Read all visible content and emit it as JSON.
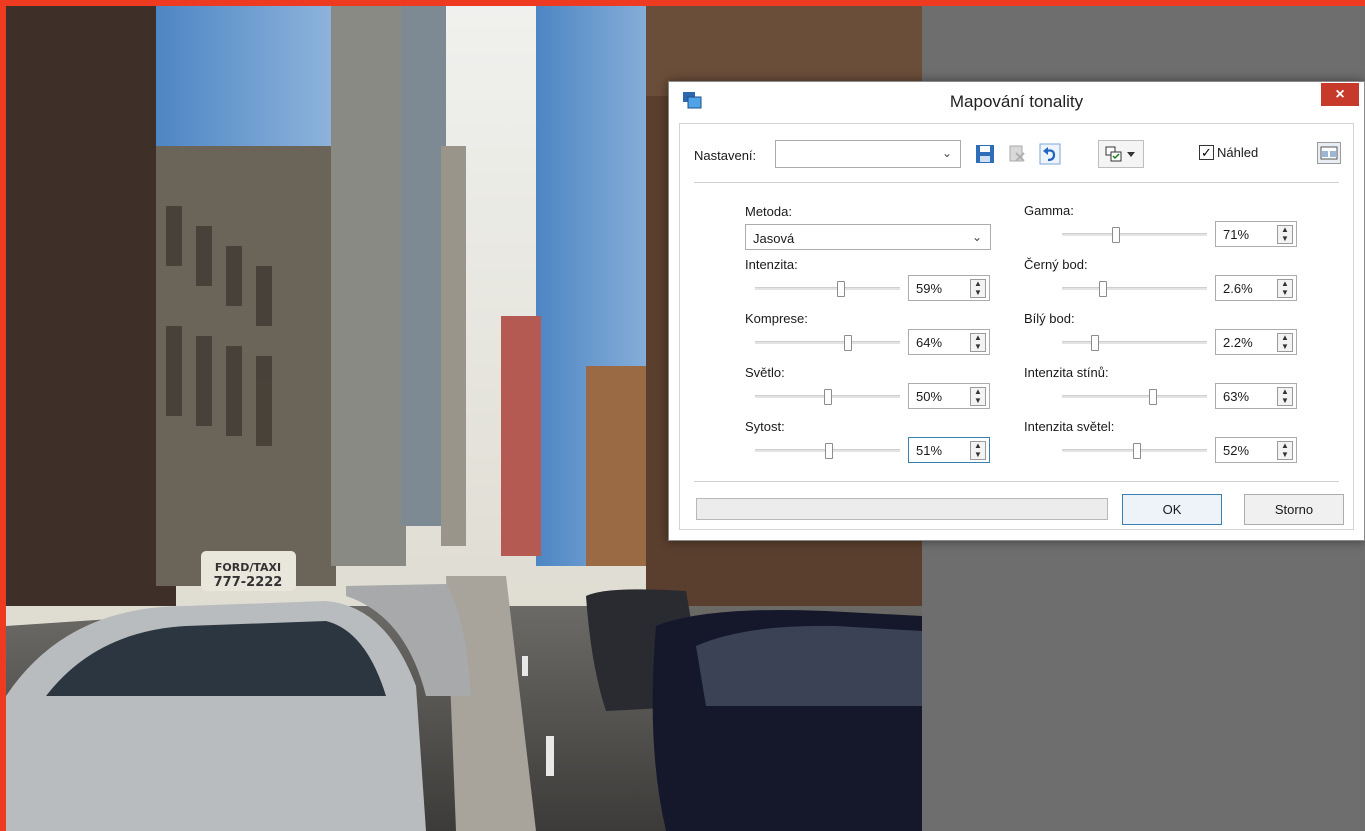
{
  "dialog": {
    "title": "Mapování tonality",
    "close_label": "×"
  },
  "toolbar": {
    "preset_label": "Nastavení:",
    "preset_value": "",
    "preview_label": "Náhled",
    "preview_checked": true
  },
  "left_params": {
    "method_label": "Metoda:",
    "method_value": "Jasová",
    "items": [
      {
        "label": "Intenzita:",
        "value_text": "59%",
        "level": 0.59
      },
      {
        "label": "Komprese:",
        "value_text": "64%",
        "level": 0.64
      },
      {
        "label": "Světlo:",
        "value_text": "50%",
        "level": 0.5
      },
      {
        "label": "Sytost:",
        "value_text": "51%",
        "level": 0.51
      }
    ]
  },
  "right_params": {
    "items": [
      {
        "label": "Gamma:",
        "value_text": "71%",
        "level": 0.37
      },
      {
        "label": "Černý bod:",
        "value_text": "2.6%",
        "level": 0.28
      },
      {
        "label": "Bílý bod:",
        "value_text": "2.2%",
        "level": 0.23
      },
      {
        "label": "Intenzita stínů:",
        "value_text": "63%",
        "level": 0.63
      },
      {
        "label": "Intenzita světel:",
        "value_text": "52%",
        "level": 0.52
      }
    ]
  },
  "buttons": {
    "ok_label": "OK",
    "cancel_label": "Storno"
  },
  "photo": {
    "taxi_sign_line1": "FORD/TAXI",
    "taxi_sign_line2": "777-2222"
  },
  "colors": {
    "frame": "#ef3a22",
    "workspace": "#6e6e6e",
    "close_button": "#c7392a",
    "focus_border": "#3c7fb1"
  }
}
